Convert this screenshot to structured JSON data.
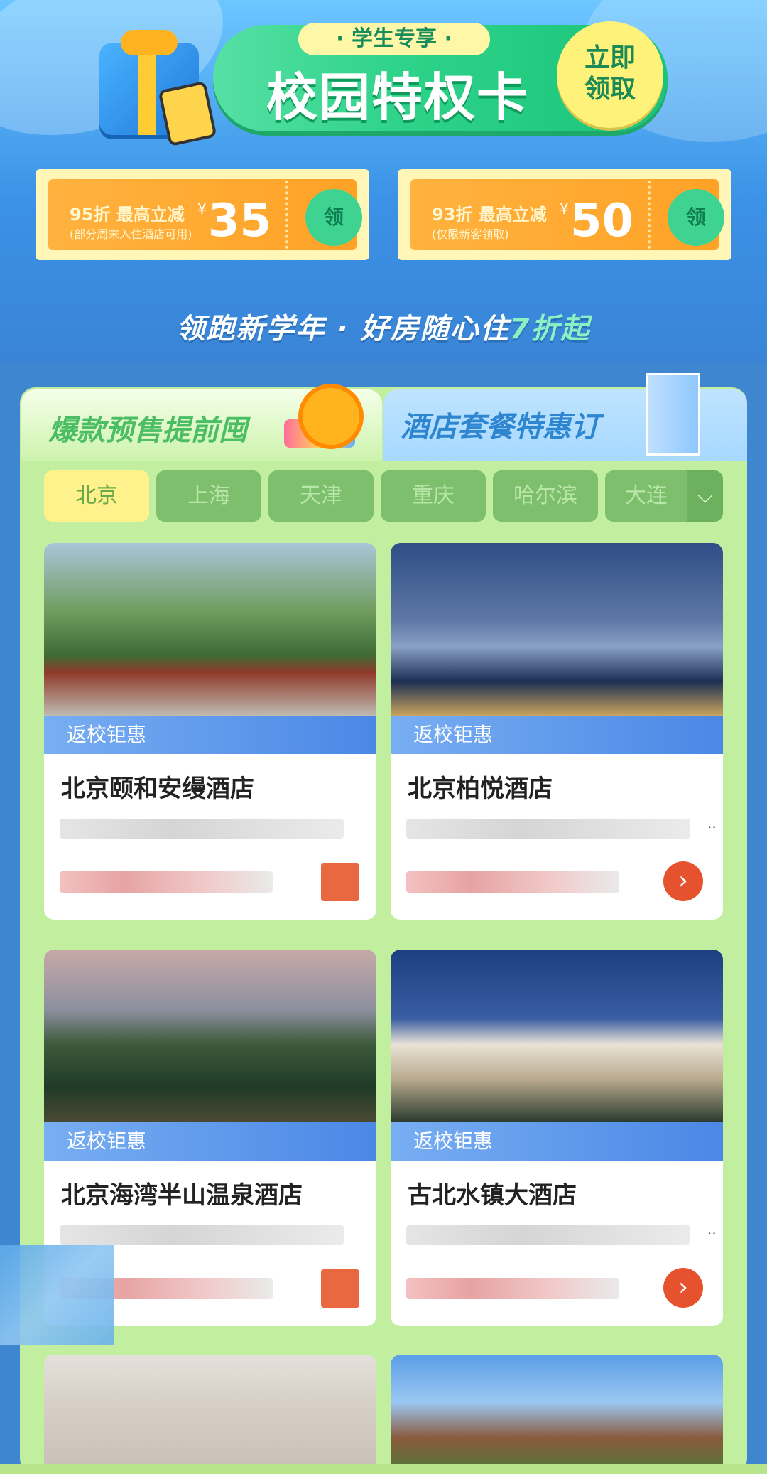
{
  "banner": {
    "subtitle": "· 学生专享 ·",
    "title": "校园特权卡",
    "claim_button": "立即领取",
    "slogan_main": "领跑新学年 · 好房随心住",
    "slogan_highlight": "7折起"
  },
  "coupons": [
    {
      "discount": "95折 最高立减",
      "note": "(部分周末入住酒店可用)",
      "currency": "¥",
      "amount": "35",
      "button": "领"
    },
    {
      "discount": "93折 最高立减",
      "note": "(仅限新客领取)",
      "currency": "¥",
      "amount": "50",
      "button": "领"
    }
  ],
  "tabs": [
    {
      "label": "爆款预售提前囤",
      "active": true
    },
    {
      "label": "酒店套餐特惠订",
      "active": false
    }
  ],
  "cities": [
    "北京",
    "上海",
    "天津",
    "重庆",
    "哈尔滨",
    "大连"
  ],
  "city_more_icon": "chevron-down-icon",
  "hotels": [
    {
      "tag": "返校钜惠",
      "name": "北京颐和安缦酒店",
      "image": "courtyard-garden"
    },
    {
      "tag": "返校钜惠",
      "name": "北京柏悦酒店",
      "image": "city-skyline-night"
    },
    {
      "tag": "返校钜惠",
      "name": "北京海湾半山温泉酒店",
      "image": "mountain-resort"
    },
    {
      "tag": "返校钜惠",
      "name": "古北水镇大酒店",
      "image": "palace-night"
    },
    {
      "tag": "",
      "name": "",
      "image": "hotel-room"
    },
    {
      "tag": "",
      "name": "",
      "image": "tropical-resort"
    }
  ],
  "colors": {
    "banner_blue": "#3b92e7",
    "pill_green": "#2fd38a",
    "coupon_orange": "#ffa226",
    "panel_green": "#c1ef9f",
    "tag_blue": "#4b87e6",
    "go_red": "#e6522e"
  }
}
